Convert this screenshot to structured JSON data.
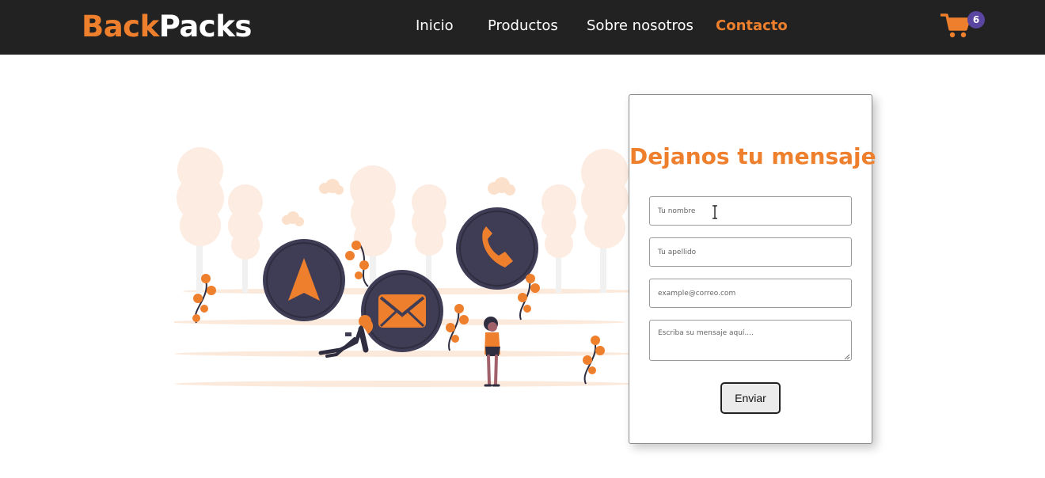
{
  "brand": {
    "part1": "Back",
    "part2": "Packs"
  },
  "nav": {
    "items": [
      {
        "label": "Inicio",
        "active": false
      },
      {
        "label": "Productos",
        "active": false
      },
      {
        "label": "Sobre nosotros",
        "active": false
      },
      {
        "label": "Contacto",
        "active": true
      }
    ]
  },
  "cart": {
    "icon": "shopping-cart-icon",
    "count": "6"
  },
  "illustration": {
    "icons": [
      "navigation-arrow-icon",
      "envelope-icon",
      "phone-icon"
    ]
  },
  "contact_form": {
    "title": "Dejanos tu mensaje",
    "first_name_placeholder": "Tu nombre",
    "last_name_placeholder": "Tu apellido",
    "email_placeholder": "example@correo.com",
    "message_placeholder": "Escriba su mensaje aquí....",
    "submit_label": "Enviar"
  },
  "colors": {
    "accent": "#ee7f2d",
    "navbar": "#222222",
    "badge": "#5a45a0",
    "circle": "#3f3d56"
  }
}
